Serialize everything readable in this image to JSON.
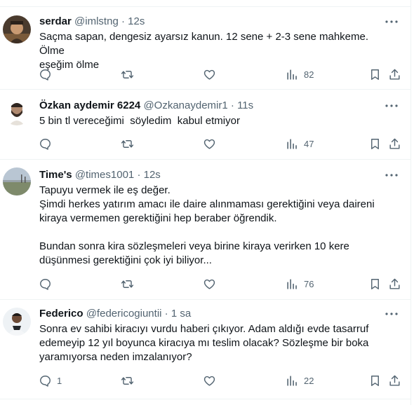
{
  "tweets": [
    {
      "name": "serdar",
      "handle": "@imlstng",
      "time": "12s",
      "text": "Saçma sapan, dengesiz ayarsız kanun. 12 sene + 2-3 sene mahkeme. Ölme\neşeğim ölme",
      "replies": "",
      "retweets": "",
      "likes": "",
      "views": "82",
      "avatar_colors": [
        "#5a4a3a",
        "#c9a27a"
      ]
    },
    {
      "name": "Özkan aydemir 6224",
      "handle": "@Ozkanaydemir1",
      "time": "11s",
      "text": "5 bin tl vereceğimi  söyledim  kabul etmiyor",
      "replies": "",
      "retweets": "",
      "likes": "",
      "views": "47",
      "avatar_colors": [
        "#e8e4df",
        "#8a6e5a"
      ]
    },
    {
      "name": "Time's",
      "handle": "@times1001",
      "time": "12s",
      "text": "Tapuyu vermek ile eş değer.\nŞimdi herkes yatırım amacı ile daire alınmaması gerektiğini veya daireni\nkiraya vermemen gerektiğini hep beraber öğrendik.\n\nBundan sonra kira sözleşmeleri veya birine kiraya verirken 10 kere\ndüşünmesi gerektiğini çok iyi biliyor...",
      "replies": "",
      "retweets": "",
      "likes": "",
      "views": "76",
      "avatar_colors": [
        "#a9b7c6",
        "#6d7a64"
      ]
    },
    {
      "name": "Federico",
      "handle": "@federicogiuntii",
      "time": "1 sa",
      "text": "Sonra ev sahibi kiracıyı vurdu haberi çıkıyor. Adam aldığı evde tasarruf\nedemeyip 12 yıl boyunca kiracıya mı teslim olacak? Sözleşme bir boka\nyaramıyorsa neden imzalanıyor?",
      "replies": "1",
      "retweets": "",
      "likes": "",
      "views": "22",
      "avatar_colors": [
        "#e9eef2",
        "#2a2a2a"
      ]
    }
  ],
  "separator": "·"
}
